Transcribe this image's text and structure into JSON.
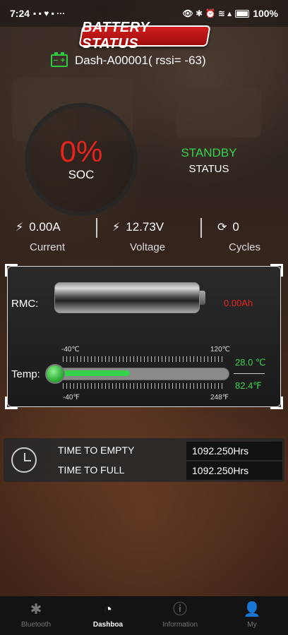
{
  "statusbar": {
    "time": "7:24",
    "battery_percent": "100%"
  },
  "header": {
    "title": "BATTERY STATUS",
    "device_name": "Dash-A00001( rssi= -63)"
  },
  "summary": {
    "soc_value": "0%",
    "soc_label": "SOC",
    "status_value": "STANDBY",
    "status_label": "STATUS"
  },
  "metrics": [
    {
      "value": "0.00A",
      "label": "Current",
      "icon": "bolt-icon"
    },
    {
      "value": "12.73V",
      "label": "Voltage",
      "icon": "bolt-icon"
    },
    {
      "value": "0",
      "label": "Cycles",
      "icon": "cycle-icon"
    }
  ],
  "panel": {
    "rmc_label": "RMC:",
    "rmc_value": "0.00Ah",
    "temp_label": "Temp:",
    "scale_c_min": "-40℃",
    "scale_c_max": "120℃",
    "scale_f_min": "-40℉",
    "scale_f_max": "248℉",
    "temp_c": "28.0 ℃",
    "temp_f": "82.4℉",
    "temp_fill_fraction": 0.43
  },
  "time": {
    "empty_label": "TIME TO EMPTY",
    "empty_value": "1092.250Hrs",
    "full_label": "TIME TO FULL",
    "full_value": "1092.250Hrs"
  },
  "nav": [
    {
      "label": "Bluetooth",
      "icon": "bluetooth-icon"
    },
    {
      "label": "Dashboa",
      "icon": "dashboard-icon"
    },
    {
      "label": "Information",
      "icon": "info-icon"
    },
    {
      "label": "My",
      "icon": "user-icon"
    }
  ],
  "colors": {
    "accent_red": "#e8231f",
    "accent_green": "#35d24a"
  }
}
